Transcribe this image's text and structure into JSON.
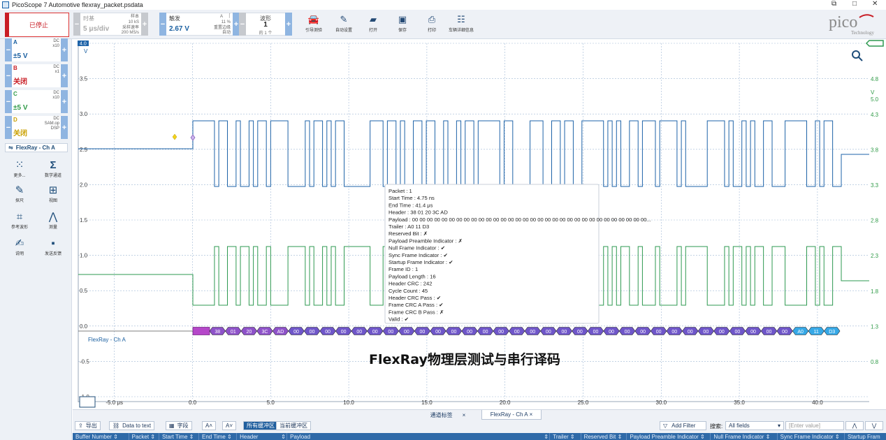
{
  "window": {
    "title": "PicoScope 7 Automotive flexray_packet.psdata",
    "controls": [
      "⧉",
      "□",
      "✕"
    ]
  },
  "toolbar": {
    "stop_label": "已停止",
    "timebase": {
      "label": "时基",
      "value": "5 μs/div",
      "samples": "样本",
      "samples_value": "10 kS",
      "rate": "采样速率",
      "rate_value": "200 MS/s"
    },
    "trigger": {
      "label": "触发",
      "value": "2.67 V",
      "channel": "A",
      "percent": "11 %",
      "edge": "重置边缘",
      "mode": "自动"
    },
    "waveforms": {
      "label": "波形",
      "value": "1",
      "sub": "的 1 个"
    },
    "tools": [
      {
        "icon": "car-icon",
        "label": "引导测验"
      },
      {
        "icon": "probe-icon",
        "label": "自动设置"
      },
      {
        "icon": "folder-icon",
        "label": "打开"
      },
      {
        "icon": "save-icon",
        "label": "保存"
      },
      {
        "icon": "print-icon",
        "label": "打印"
      },
      {
        "icon": "clipboard-icon",
        "label": "车辆详细信息"
      }
    ]
  },
  "channels": [
    {
      "name": "A",
      "coupling": "DC",
      "probe": "x10",
      "value": "±5 V",
      "color": "#1a5fa0",
      "value_color": "#1a5fa0"
    },
    {
      "name": "B",
      "coupling": "DC",
      "probe": "x1",
      "value": "关闭",
      "color": "#c81d25",
      "value_color": "#c81d25"
    },
    {
      "name": "C",
      "coupling": "DC",
      "probe": "x10",
      "value": "±5 V",
      "color": "#2f9a47",
      "value_color": "#2f9a47"
    },
    {
      "name": "D",
      "coupling": "DC",
      "probe": "SAM.op",
      "probe2": "DSP",
      "value": "关闭",
      "color": "#c9a000",
      "value_color": "#c9a000"
    }
  ],
  "decoder_label": "FlexRay - Ch A",
  "left_tools": [
    {
      "icon": "more-icon",
      "label": "更多..."
    },
    {
      "icon": "math-icon",
      "label": "数学通道"
    },
    {
      "icon": "pen-icon",
      "label": "探尺"
    },
    {
      "icon": "view-icon",
      "label": "视图"
    },
    {
      "icon": "reference-icon",
      "label": "参考波形"
    },
    {
      "icon": "measure-icon",
      "label": "测量"
    },
    {
      "icon": "notes-icon",
      "label": "说明"
    },
    {
      "icon": "feedback-icon",
      "label": "发送反馈"
    }
  ],
  "graph": {
    "left_axis": {
      "unit": "V",
      "ticks": [
        "4.0",
        "3.5",
        "3.0",
        "2.5",
        "2.0",
        "1.5",
        "1.0",
        "0.5",
        "0.0",
        "-0.5",
        "-1.0"
      ]
    },
    "right_axis": {
      "unit": "V",
      "top": "5.0",
      "ticks": [
        "4.8",
        "4.3",
        "3.8",
        "3.3",
        "2.8",
        "2.3",
        "1.8",
        "1.3",
        "0.8"
      ]
    },
    "x_axis": {
      "unit": "μs",
      "ticks": [
        "-5.0 μs",
        "0.0",
        "5.0",
        "10.0",
        "15.0",
        "20.0",
        "25.0",
        "30.0",
        "35.0",
        "40.0"
      ]
    },
    "decode_label": "FlexRay - Ch A",
    "decode_bytes": [
      "38",
      "01",
      "20",
      "3C",
      "AD",
      "00",
      "00",
      "00",
      "00",
      "00",
      "00",
      "00",
      "00",
      "00",
      "00",
      "00",
      "00",
      "00",
      "00",
      "00",
      "00",
      "00",
      "00",
      "00",
      "00",
      "00",
      "00",
      "00",
      "00",
      "00",
      "00",
      "00",
      "00",
      "00",
      "00",
      "00",
      "00",
      "A0",
      "11",
      "D3"
    ],
    "overlay_title": "FlexRay物理层测试与串行译码"
  },
  "tooltip": [
    "Packet :  1",
    "Start Time :  4.75 ns",
    "End Time :  41.4 μs",
    "Header :  38 01 20 3C AD",
    "Payload :  00 00 00 00 00 00 00 00 00 00 00 00 00 00 00 00 00 00 00 00 00 00 00 00 00 00 00 00 00 00 00 00...",
    "Trailer :  A0 11 D3",
    "Reserved Bit :  ✗",
    "Payload Preamble Indicator :  ✗",
    "Null Frame Indicator :  ✔",
    "Sync Frame Indicator :  ✔",
    "Startup Frame Indicator :  ✔",
    "Frame ID :  1",
    "Payload Length :  16",
    "Header CRC :  242",
    "Cycle Count :  45",
    "Header CRC Pass :  ✔",
    "Frame CRC A Pass :  ✔",
    "Frame CRC B Pass :  ✗",
    "Valid :  ✔"
  ],
  "bottom": {
    "tabs": [
      "通道标签",
      "FlexRay - Ch A"
    ],
    "export": "导出",
    "data_to_text": "Data to text",
    "fields": "字段",
    "buffer_all": "所有缓冲区",
    "buffer_current": "当前缓冲区",
    "add_filter": "Add Filter",
    "search_label": "搜索:",
    "search_value": "All fields",
    "enter_placeholder": "Enter value",
    "columns": [
      "Buffer Number ⇕",
      "Packet ⇕",
      "Start Time ⇕",
      "End Time ⇕",
      "Header",
      "⇕",
      "Payload",
      "⇕",
      "Trailer ⇕",
      "Reserved Bit ⇕",
      "Payload Preamble Indicator ⇕",
      "Null Frame Indicator ⇕",
      "Sync Frame Indicator ⇕",
      "Startup Fram"
    ]
  }
}
